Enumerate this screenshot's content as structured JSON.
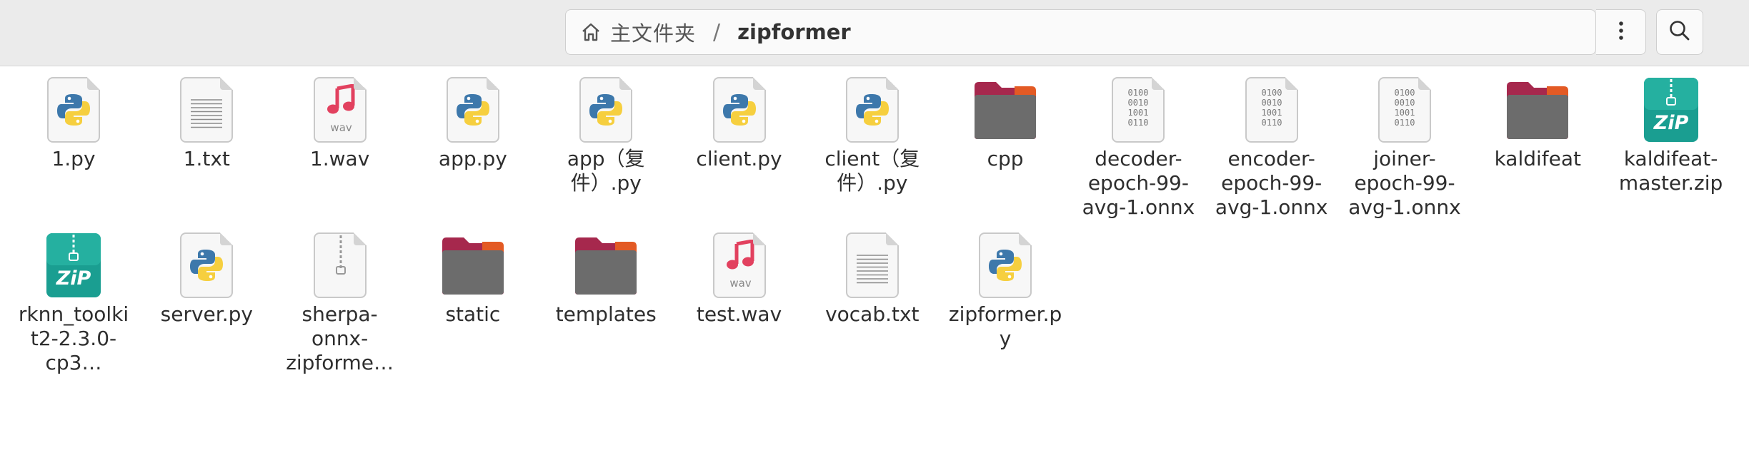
{
  "pathbar": {
    "parent": "主文件夹",
    "separator": "/",
    "current": "zipformer"
  },
  "files": [
    {
      "name": "1.py",
      "type": "python"
    },
    {
      "name": "1.txt",
      "type": "text"
    },
    {
      "name": "1.wav",
      "type": "audio",
      "badge": "WAV"
    },
    {
      "name": "app.py",
      "type": "python"
    },
    {
      "name": "app（复件）.py",
      "type": "python"
    },
    {
      "name": "client.py",
      "type": "python"
    },
    {
      "name": "client（复件）.py",
      "type": "python"
    },
    {
      "name": "cpp",
      "type": "folder"
    },
    {
      "name": "decoder-epoch-99-avg-1.onnx",
      "type": "binary"
    },
    {
      "name": "encoder-epoch-99-avg-1.onnx",
      "type": "binary"
    },
    {
      "name": "joiner-epoch-99-avg-1.onnx",
      "type": "binary"
    },
    {
      "name": "kaldifeat",
      "type": "folder"
    },
    {
      "name": "kaldifeat-master.zip",
      "type": "zip"
    },
    {
      "name": "rknn_toolkit2-2.3.0-cp3…",
      "type": "zip"
    },
    {
      "name": "server.py",
      "type": "python"
    },
    {
      "name": "sherpa-onnx-zipforme…",
      "type": "archive"
    },
    {
      "name": "static",
      "type": "folder"
    },
    {
      "name": "templates",
      "type": "folder"
    },
    {
      "name": "test.wav",
      "type": "audio",
      "badge": "WAV"
    },
    {
      "name": "vocab.txt",
      "type": "text"
    },
    {
      "name": "zipformer.py",
      "type": "python"
    }
  ],
  "colors": {
    "python_blue": "#3d78ab",
    "python_yellow": "#f6cf3f",
    "audio_pink": "#e2415f",
    "folder_top": "#a6284d",
    "folder_body": "#6c6c6c",
    "zip_teal": "#1a9e91"
  }
}
